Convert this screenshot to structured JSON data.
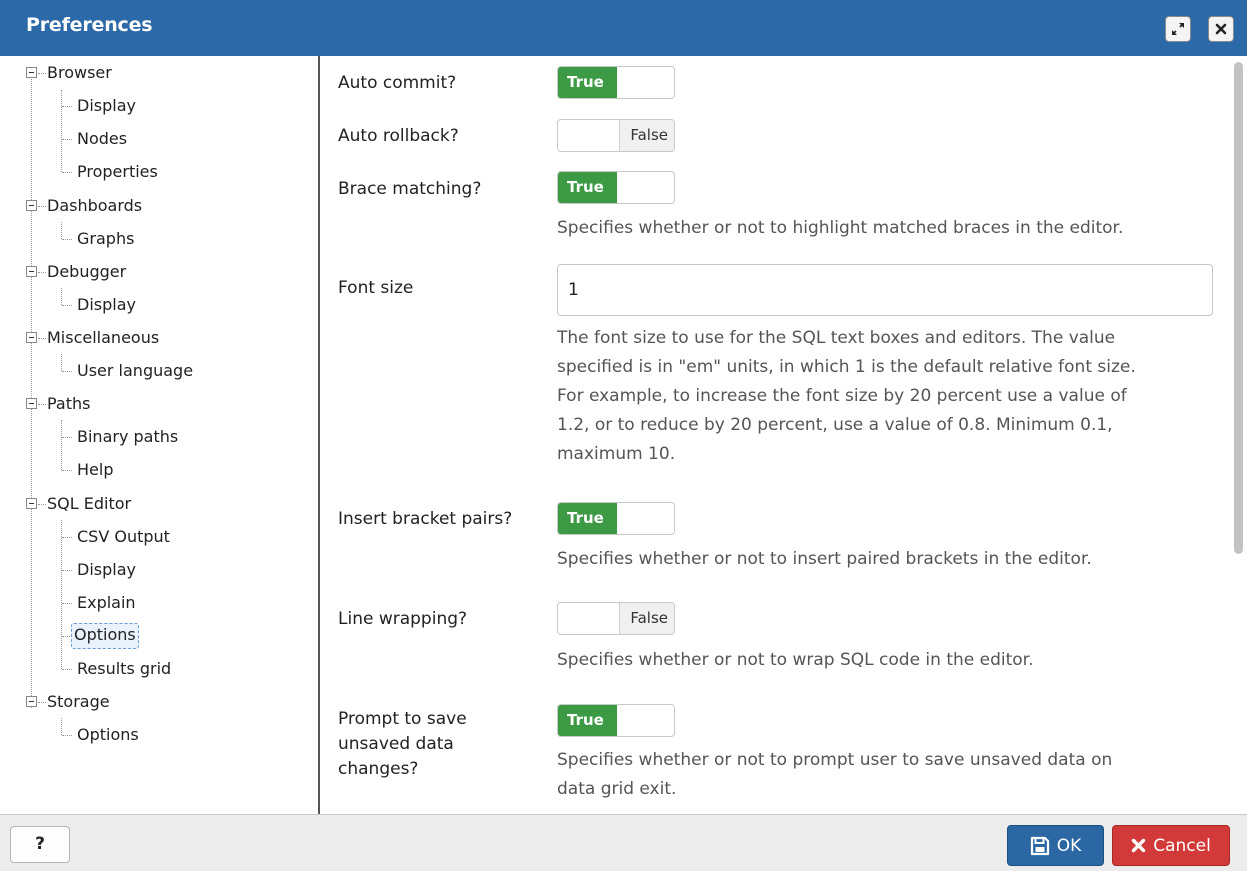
{
  "window": {
    "title": "Preferences"
  },
  "titlebar_buttons": {
    "maximize": "maximize-icon",
    "close": "close-icon"
  },
  "tree": [
    {
      "label": "Browser",
      "children": [
        "Display",
        "Nodes",
        "Properties"
      ]
    },
    {
      "label": "Dashboards",
      "children": [
        "Graphs"
      ]
    },
    {
      "label": "Debugger",
      "children": [
        "Display"
      ]
    },
    {
      "label": "Miscellaneous",
      "children": [
        "User language"
      ]
    },
    {
      "label": "Paths",
      "children": [
        "Binary paths",
        "Help"
      ]
    },
    {
      "label": "SQL Editor",
      "children": [
        "CSV Output",
        "Display",
        "Explain",
        "Options",
        "Results grid"
      ]
    },
    {
      "label": "Storage",
      "children": [
        "Options"
      ]
    }
  ],
  "selected": "SQL Editor > Options",
  "settings": {
    "auto_commit": {
      "label": "Auto commit?",
      "value": "True"
    },
    "auto_rollback": {
      "label": "Auto rollback?",
      "value": "False"
    },
    "brace_matching": {
      "label": "Brace matching?",
      "value": "True",
      "help": "Specifies whether or not to highlight matched braces in the editor."
    },
    "font_size": {
      "label": "Font size",
      "value": "1",
      "help_lines": [
        "The font size to use for the SQL text boxes and editors. The value",
        "specified is in \"em\" units, in which 1 is the default relative font size.",
        "For example, to increase the font size by 20 percent use a value of",
        "1.2, or to reduce by 20 percent, use a value of 0.8. Minimum 0.1,",
        "maximum 10."
      ]
    },
    "insert_bracket_pairs": {
      "label": "Insert bracket pairs?",
      "value": "True",
      "help": "Specifies whether or not to insert paired brackets in the editor."
    },
    "line_wrapping": {
      "label": "Line wrapping?",
      "value": "False",
      "help": "Specifies whether or not to wrap SQL code in the editor."
    },
    "prompt_save": {
      "label_lines": [
        "Prompt to save",
        "unsaved data",
        "changes?"
      ],
      "value": "True",
      "help_lines": [
        "Specifies whether or not to prompt user to save unsaved data on",
        "data grid exit."
      ]
    }
  },
  "footer": {
    "help": "?",
    "ok": "OK",
    "cancel": "Cancel"
  },
  "colors": {
    "titlebar": "#2b69a8",
    "toggle_on": "#3c9a44",
    "ok": "#2b67a3",
    "cancel": "#d23a3a"
  }
}
